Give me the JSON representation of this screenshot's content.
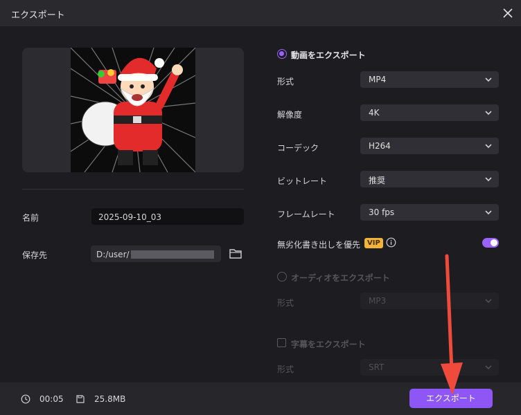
{
  "window": {
    "title": "エクスポート"
  },
  "left": {
    "name_label": "名前",
    "name_value": "2025-09-10_03",
    "save_label": "保存先",
    "save_path_prefix": "D:/user/"
  },
  "video": {
    "section_label": "動画をエクスポート",
    "format_label": "形式",
    "format_value": "MP4",
    "resolution_label": "解像度",
    "resolution_value": "4K",
    "codec_label": "コーデック",
    "codec_value": "H264",
    "bitrate_label": "ビットレート",
    "bitrate_value": "推奨",
    "framerate_label": "フレームレート",
    "framerate_value": "30  fps",
    "lossless_label": "無劣化書き出しを優先",
    "vip_badge": "VIP",
    "lossless_enabled": true
  },
  "audio": {
    "section_label": "オーディオをエクスポート",
    "format_label": "形式",
    "format_value": "MP3"
  },
  "subtitle": {
    "section_label": "字幕をエクスポート",
    "format_label": "形式",
    "format_value": "SRT"
  },
  "footer": {
    "duration": "00:05",
    "size": "25.8MB",
    "export_label": "エクスポート"
  },
  "colors": {
    "accent": "#8e56f5",
    "background": "#1d1d21",
    "annotation_arrow": "#f04a3c"
  },
  "icons": {
    "close": "close-icon",
    "folder": "folder-icon",
    "info": "info-icon",
    "clock": "clock-icon",
    "disk": "save-icon",
    "chevron": "chevron-down-icon"
  }
}
